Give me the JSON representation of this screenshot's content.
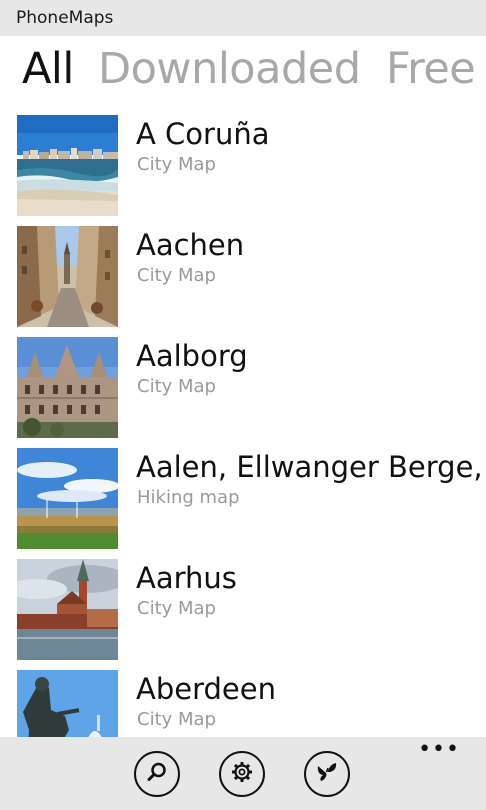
{
  "app": {
    "title": "PhoneMaps"
  },
  "pivot": {
    "tabs": [
      "All",
      "Downloaded",
      "Free"
    ]
  },
  "maps": [
    {
      "name": "A Coruña",
      "type": "City Map"
    },
    {
      "name": "Aachen",
      "type": "City Map"
    },
    {
      "name": "Aalborg",
      "type": "City Map"
    },
    {
      "name": "Aalen, Ellwanger Berge, I",
      "type": "Hiking map"
    },
    {
      "name": "Aarhus",
      "type": "City Map"
    },
    {
      "name": "Aberdeen",
      "type": "City Map"
    }
  ],
  "appbar": {
    "buttons": [
      "search-icon",
      "settings-gear-icon",
      "butterfly-icon"
    ],
    "more_label": "•••"
  }
}
